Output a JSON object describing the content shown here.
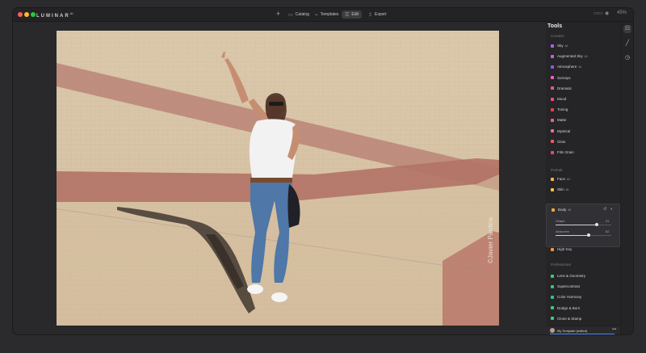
{
  "app": {
    "brand": "LUMINAR",
    "brand_sup": "AI"
  },
  "nav": {
    "plus": "+",
    "catalog": "Catalog",
    "templates": "Templates",
    "edit": "Edit",
    "export": "Export"
  },
  "view": {
    "zoom": "45%"
  },
  "photo": {
    "watermark": "©Javier Pardina"
  },
  "panel": {
    "title": "Tools",
    "sections": {
      "creative": "Creative",
      "portrait": "Portrait",
      "professional": "Professional"
    },
    "creative_tools": [
      {
        "label": "Sky",
        "ai": "AI",
        "color": "#b55cff"
      },
      {
        "label": "Augmented Sky",
        "ai": "AI",
        "color": "#cf55ff"
      },
      {
        "label": "Atmosphere",
        "ai": "AI",
        "color": "#8f57ff"
      },
      {
        "label": "Sunrays",
        "ai": "",
        "color": "#ff5bb7"
      },
      {
        "label": "Dramatic",
        "ai": "",
        "color": "#ff4f9d"
      },
      {
        "label": "Mood",
        "ai": "",
        "color": "#ff4a7a"
      },
      {
        "label": "Toning",
        "ai": "",
        "color": "#ff3b3b"
      },
      {
        "label": "Matte",
        "ai": "",
        "color": "#ff5f7a"
      },
      {
        "label": "Mystical",
        "ai": "",
        "color": "#ff6a95"
      },
      {
        "label": "Glow",
        "ai": "",
        "color": "#ff5a5a"
      },
      {
        "label": "Film Grain",
        "ai": "",
        "color": "#ff3c7d"
      }
    ],
    "portrait_tools": [
      {
        "label": "Face",
        "ai": "AI",
        "color": "#ffb347"
      },
      {
        "label": "Skin",
        "ai": "AI",
        "color": "#ffc04d"
      },
      {
        "label": "Body",
        "ai": "AI",
        "color": "#f2a83a"
      },
      {
        "label": "High Key",
        "ai": "",
        "color": "#ff9240"
      }
    ],
    "body_sliders": [
      {
        "label": "Shape",
        "value": "31",
        "percent": 0.74
      },
      {
        "label": "Abdomen",
        "value": "62",
        "percent": 0.6
      }
    ],
    "professional_tools": [
      {
        "label": "Lens & Geometry",
        "ai": "",
        "color": "#33d17a"
      },
      {
        "label": "Supercontrast",
        "ai": "",
        "color": "#2ecc71"
      },
      {
        "label": "Color Harmony",
        "ai": "",
        "color": "#27c3a6"
      },
      {
        "label": "Dodge & Burn",
        "ai": "",
        "color": "#3bd16f"
      },
      {
        "label": "Clone & Stamp",
        "ai": "",
        "color": "#2fd480"
      }
    ],
    "template": {
      "name": "My Template (edited)",
      "more": "•••"
    }
  },
  "colors": {
    "accent": "#4c8cf5"
  }
}
